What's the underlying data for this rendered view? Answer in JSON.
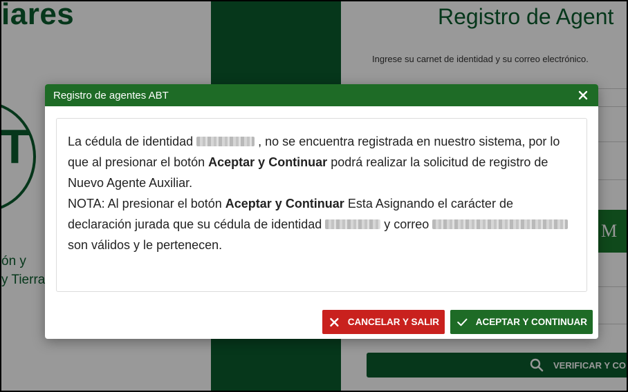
{
  "background": {
    "brand_title": "iares",
    "brand_sub_1": "ón y",
    "brand_sub_2": "y Tierra",
    "form_title": "Registro de Agent",
    "form_instructions": "Ingrese su carnet de identidad y su correo electrónico.",
    "green_button_label": "M I",
    "verify_button_label": "VERIFICAR Y CO",
    "verify_icon": "search-icon"
  },
  "modal": {
    "title": "Registro de agentes ABT",
    "close_icon": "close-icon",
    "message": {
      "p1_a": "La cédula de identidad ",
      "p1_b": " , no se encuentra registrada en nuestro sistema, por lo que al presionar el botón ",
      "p1_bold": "Aceptar y Continuar",
      "p1_c": " podrá realizar la solicitud de registro de Nuevo Agente Auxiliar.",
      "p2_a": "NOTA: Al presionar el botón ",
      "p2_bold": "Aceptar y Continuar",
      "p2_b": " Esta Asignando el carácter de declaración jurada que su cédula de identidad ",
      "p2_c": " y correo ",
      "p2_d": " son válidos y le pertenecen."
    },
    "buttons": {
      "cancel_label": "CANCELAR Y SALIR",
      "cancel_icon": "x-icon",
      "accept_label": "ACEPTAR Y CONTINUAR",
      "accept_icon": "check-icon"
    }
  },
  "colors": {
    "brand_green": "#0b5c2d",
    "header_green": "#1e6b26",
    "cancel_red": "#c9211e"
  }
}
